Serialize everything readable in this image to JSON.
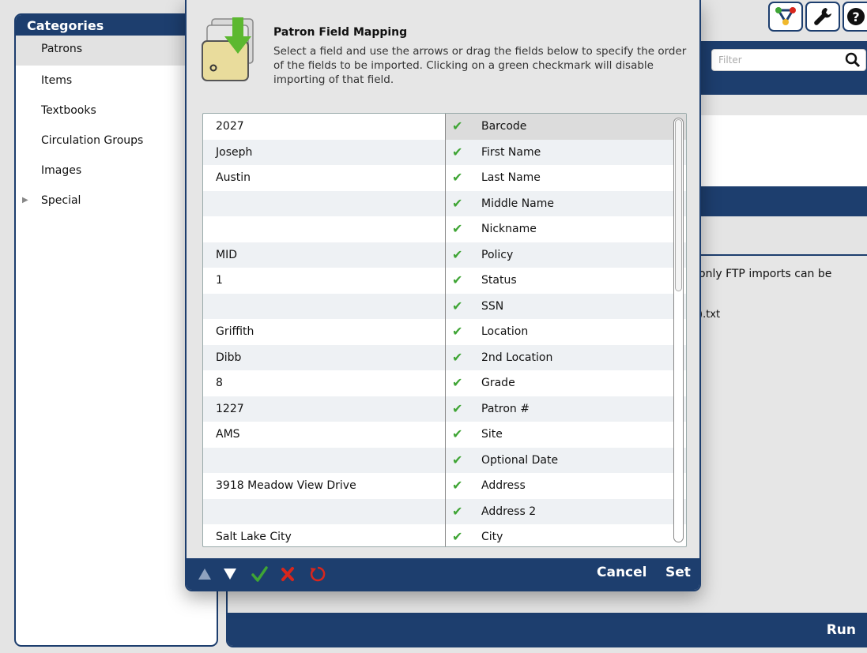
{
  "sidebar": {
    "title": "Categories",
    "items": [
      {
        "label": "Patrons"
      },
      {
        "label": "Items"
      },
      {
        "label": "Textbooks"
      },
      {
        "label": "Circulation Groups"
      },
      {
        "label": "Images"
      },
      {
        "label": "Special"
      }
    ]
  },
  "toolbar": {
    "icons": [
      "network-icon",
      "wrench-icon",
      "help-icon"
    ]
  },
  "filter": {
    "placeholder": "Filter"
  },
  "background_panel": {
    "note_line1": "only FTP imports can be",
    "note_line2": ").txt",
    "run_label": "Run"
  },
  "modal": {
    "title": "Patron Field Mapping",
    "description": "Select a field and use the arrows or drag the fields below to specify the order of the fields to be imported. Clicking on a green checkmark will disable importing of that field.",
    "values": [
      "2027",
      "Joseph",
      "Austin",
      "",
      "",
      "MID",
      "1",
      "",
      "Griffith",
      "Dibb",
      "8",
      "1227",
      "AMS",
      "",
      "3918 Meadow View Drive",
      "",
      "Salt Lake City"
    ],
    "fields": [
      "Barcode",
      "First Name",
      "Last Name",
      "Middle Name",
      "Nickname",
      "Policy",
      "Status",
      "SSN",
      "Location",
      "2nd Location",
      "Grade",
      "Patron #",
      "Site",
      "Optional Date",
      "Address",
      "Address 2",
      "City"
    ],
    "selected_field": "Barcode",
    "cancel_label": "Cancel",
    "set_label": "Set"
  },
  "colors": {
    "navy": "#1d3e6e",
    "check_green": "#3fa535",
    "disable_red": "#d9261c"
  }
}
